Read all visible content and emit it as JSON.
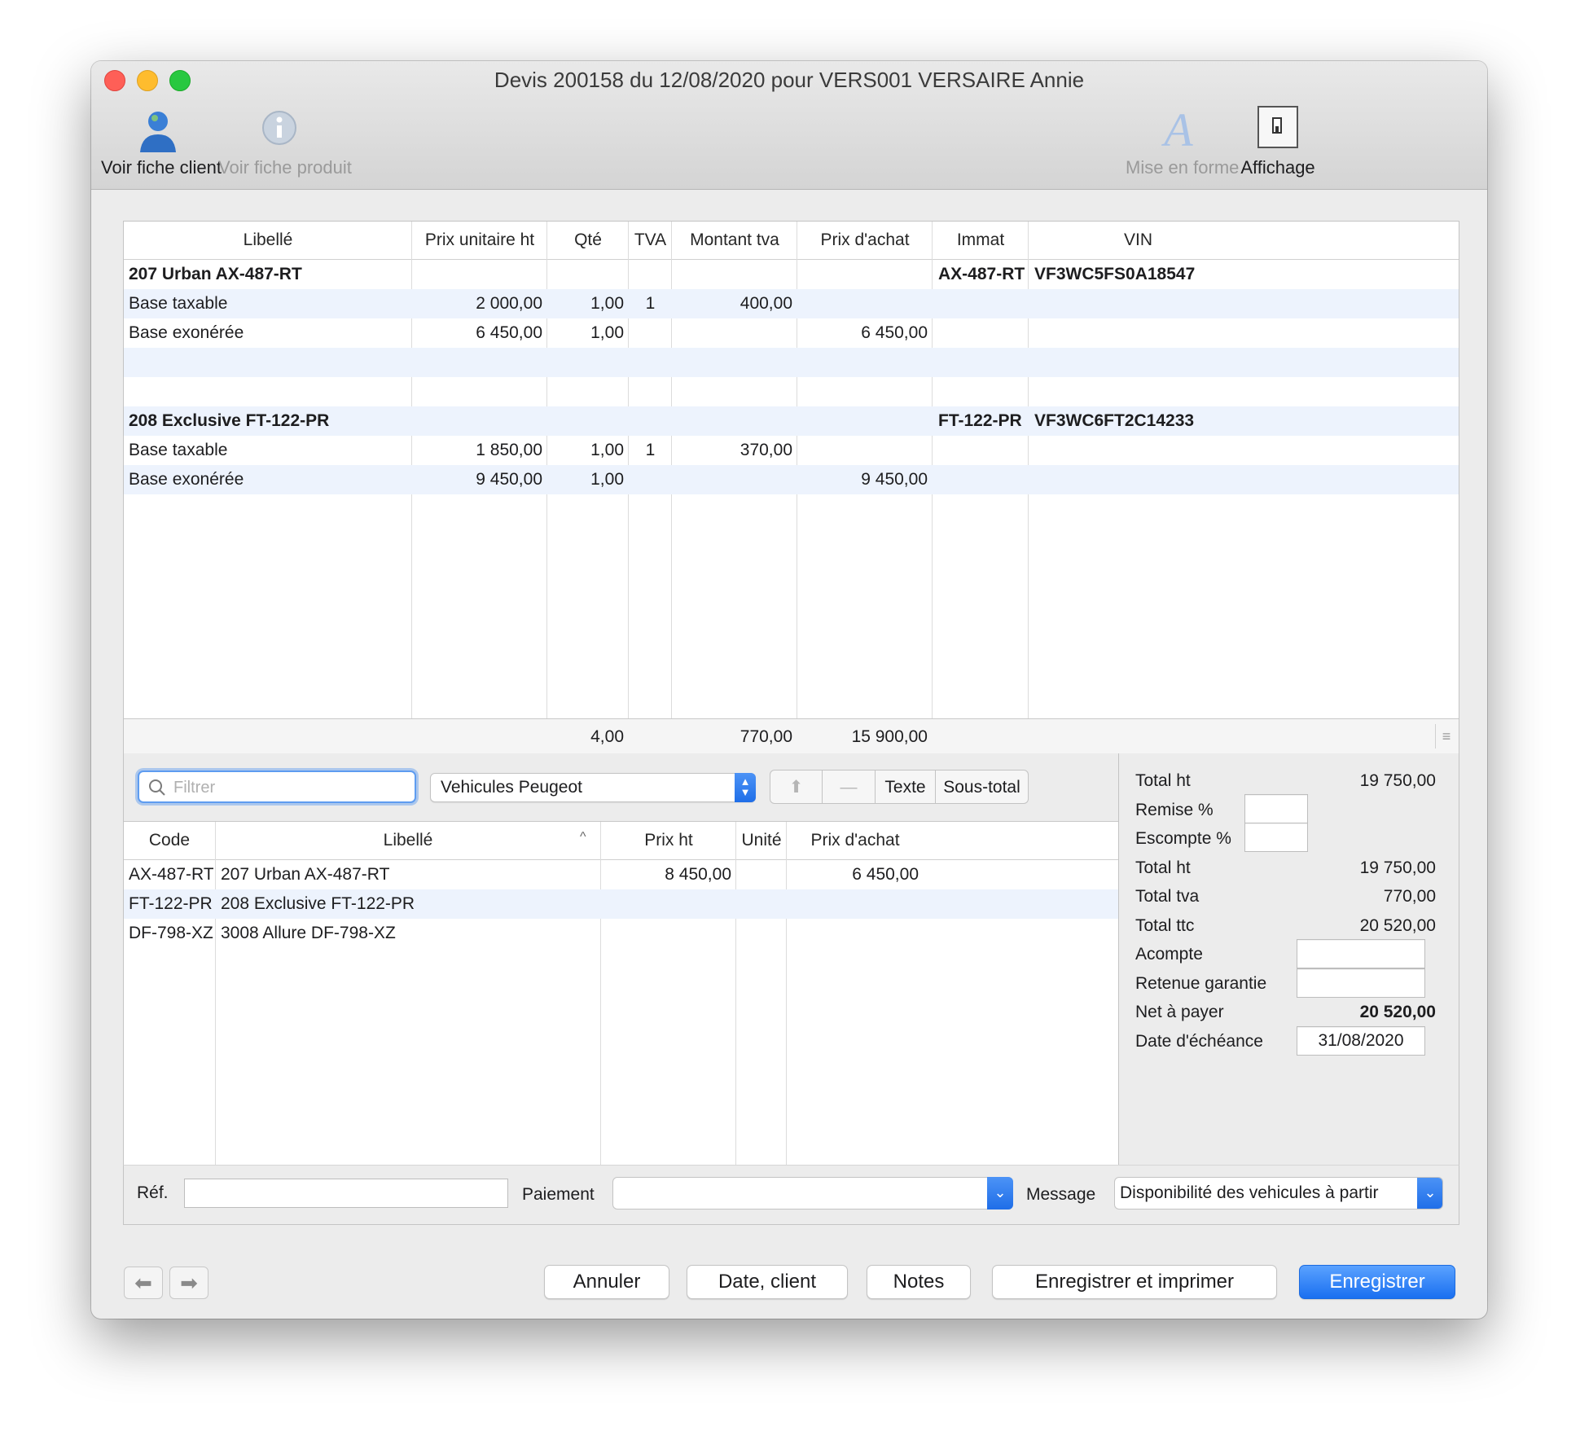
{
  "window": {
    "title": "Devis 200158 du 12/08/2020 pour VERS001 VERSAIRE Annie"
  },
  "toolbar": {
    "voir_fiche_client": "Voir fiche client",
    "voir_fiche_produit": "Voir fiche produit",
    "mise_en_forme": "Mise en forme",
    "affichage": "Affichage"
  },
  "lines_table": {
    "headers": [
      "Libellé",
      "Prix unitaire ht",
      "Qté",
      "TVA",
      "Montant tva",
      "Prix d'achat",
      "Immat",
      "VIN"
    ],
    "rows": [
      {
        "libelle": "207 Urban AX-487-RT",
        "prix": "",
        "qte": "",
        "tva": "",
        "montant_tva": "",
        "prix_achat": "",
        "immat": "AX-487-RT",
        "vin": "VF3WC5FS0A18547"
      },
      {
        "libelle": "Base taxable",
        "prix": "2 000,00",
        "qte": "1,00",
        "tva": "1",
        "montant_tva": "400,00",
        "prix_achat": "",
        "immat": "",
        "vin": ""
      },
      {
        "libelle": "Base exonérée",
        "prix": "6 450,00",
        "qte": "1,00",
        "tva": "",
        "montant_tva": "",
        "prix_achat": "6 450,00",
        "immat": "",
        "vin": ""
      },
      {
        "libelle": "",
        "prix": "",
        "qte": "",
        "tva": "",
        "montant_tva": "",
        "prix_achat": "",
        "immat": "",
        "vin": ""
      },
      {
        "libelle": "",
        "prix": "",
        "qte": "",
        "tva": "",
        "montant_tva": "",
        "prix_achat": "",
        "immat": "",
        "vin": ""
      },
      {
        "libelle": "208 Exclusive FT-122-PR",
        "prix": "",
        "qte": "",
        "tva": "",
        "montant_tva": "",
        "prix_achat": "",
        "immat": "FT-122-PR",
        "vin": "VF3WC6FT2C14233"
      },
      {
        "libelle": "Base taxable",
        "prix": "1 850,00",
        "qte": "1,00",
        "tva": "1",
        "montant_tva": "370,00",
        "prix_achat": "",
        "immat": "",
        "vin": ""
      },
      {
        "libelle": "Base exonérée",
        "prix": "9 450,00",
        "qte": "1,00",
        "tva": "",
        "montant_tva": "",
        "prix_achat": "9 450,00",
        "immat": "",
        "vin": ""
      }
    ],
    "footer": {
      "qte": "4,00",
      "montant_tva": "770,00",
      "prix_achat": "15 900,00"
    }
  },
  "products": {
    "filter_placeholder": "Filtrer",
    "category": "Vehicules Peugeot",
    "texte_label": "Texte",
    "sous_total_label": "Sous-total",
    "headers": [
      "Code",
      "Libellé",
      "Prix ht",
      "Unité",
      "Prix d'achat"
    ],
    "rows": [
      {
        "code": "AX-487-RT",
        "libelle": "207 Urban AX-487-RT",
        "prix_ht": "8 450,00",
        "unite": "",
        "prix_achat": "6 450,00"
      },
      {
        "code": "FT-122-PR",
        "libelle": "208 Exclusive FT-122-PR",
        "prix_ht": "",
        "unite": "",
        "prix_achat": ""
      },
      {
        "code": "DF-798-XZ",
        "libelle": "3008 Allure DF-798-XZ",
        "prix_ht": "",
        "unite": "",
        "prix_achat": ""
      }
    ]
  },
  "totals": {
    "total_ht_label": "Total ht",
    "total_ht_1": "19 750,00",
    "remise_label": "Remise %",
    "remise_value": "",
    "escompte_label": "Escompte %",
    "escompte_value": "",
    "total_ht_2": "19 750,00",
    "total_tva_label": "Total tva",
    "total_tva": "770,00",
    "total_ttc_label": "Total ttc",
    "total_ttc": "20 520,00",
    "acompte_label": "Acompte",
    "acompte_value": "",
    "retenue_label": "Retenue garantie",
    "retenue_value": "",
    "net_label": "Net à payer",
    "net_value": "20 520,00",
    "echeance_label": "Date d'échéance",
    "echeance_value": "31/08/2020"
  },
  "bottom": {
    "ref_label": "Réf.",
    "ref_value": "",
    "paiement_label": "Paiement",
    "paiement_value": "",
    "message_label": "Message",
    "message_value": "Disponibilité des vehicules à partir"
  },
  "buttons": {
    "annuler": "Annuler",
    "date_client": "Date, client",
    "notes": "Notes",
    "enregistrer_imprimer": "Enregistrer et imprimer",
    "enregistrer": "Enregistrer"
  },
  "colors": {
    "accent": "#1a6ff0",
    "row_alt": "#edf3fd",
    "window_bg": "#ececec"
  }
}
